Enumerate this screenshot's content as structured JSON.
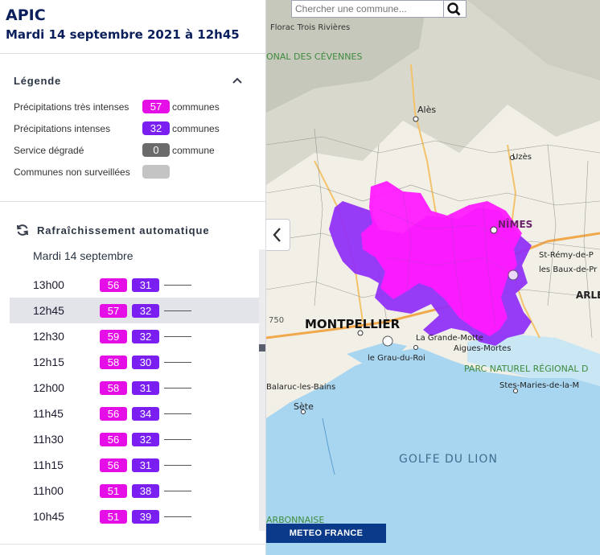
{
  "header": {
    "title": "APIC",
    "subtitle": "Mardi 14 septembre 2021 à 12h45"
  },
  "legend": {
    "title": "Légende",
    "items": [
      {
        "label": "Précipitations très intenses",
        "value": "57",
        "unit": "communes",
        "color": "#e60ee6"
      },
      {
        "label": "Précipitations intenses",
        "value": "32",
        "unit": "communes",
        "color": "#7a1ef2"
      },
      {
        "label": "Service dégradé",
        "value": "0",
        "unit": "commune",
        "color": "#6b6b6b"
      },
      {
        "label": "Communes non surveillées",
        "value": "",
        "unit": "",
        "color": "#c4c4c4"
      }
    ]
  },
  "refresh": {
    "label": "Rafraîchissement automatique",
    "icon": "refresh-icon"
  },
  "timeline": {
    "date": "Mardi 14 septembre",
    "selected_index": 1,
    "rows": [
      {
        "time": "13h00",
        "very_intense": "56",
        "intense": "31"
      },
      {
        "time": "12h45",
        "very_intense": "57",
        "intense": "32"
      },
      {
        "time": "12h30",
        "very_intense": "59",
        "intense": "32"
      },
      {
        "time": "12h15",
        "very_intense": "58",
        "intense": "30"
      },
      {
        "time": "12h00",
        "very_intense": "58",
        "intense": "31"
      },
      {
        "time": "11h45",
        "very_intense": "56",
        "intense": "34"
      },
      {
        "time": "11h30",
        "very_intense": "56",
        "intense": "32"
      },
      {
        "time": "11h15",
        "very_intense": "56",
        "intense": "31"
      },
      {
        "time": "11h00",
        "very_intense": "51",
        "intense": "38"
      },
      {
        "time": "10h45",
        "very_intense": "51",
        "intense": "39"
      }
    ]
  },
  "map": {
    "search_placeholder": "Chercher une commune...",
    "brand": "METEO FRANCE",
    "labels": {
      "montpellier": "MONTPELLIER",
      "nimes": "NÎMES",
      "ales": "Alès",
      "uzes": "Uzès",
      "florac": "Florac Trois Rivières",
      "cevennes": "ONAL DES CÉVENNES",
      "golfe": "GOLFE DU LION",
      "parc_camargue": "PARC NATUREL RÉGIONAL D",
      "grande_motte": "La Grande-Motte",
      "aigues_mortes": "Aigues-Mortes",
      "grau": "le Grau-du-Roi",
      "balaruc": "Balaruc-les-Bains",
      "sete": "Sète",
      "saintes_maries": "Stes-Maries-de-la-M",
      "st_remy": "St-Rémy-de-P",
      "baux": "les Baux-de-Pr",
      "arles": "ARLE",
      "narbonnaise": "ARBONNAISE",
      "alt_750": "750"
    },
    "colors": {
      "very_intense": "#ff1aff",
      "intense": "#8f2cf7",
      "sea": "#a8d6f0",
      "land": "#f2efe6",
      "relief": "#cfcfc4"
    }
  }
}
